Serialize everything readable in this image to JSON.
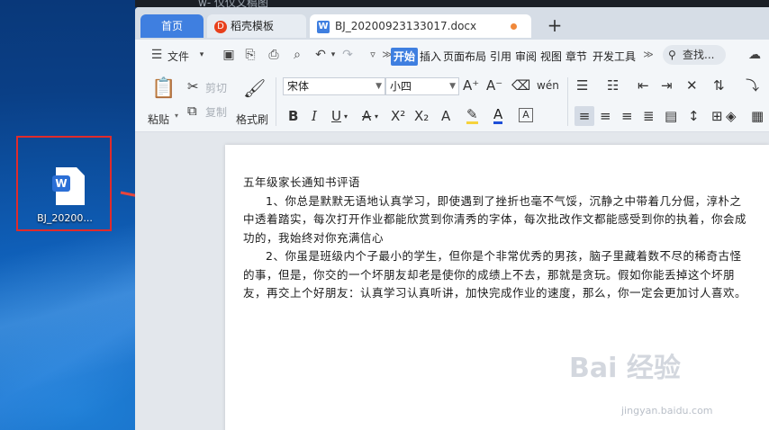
{
  "window": {
    "title_fragment": "w- 仪仪文稿图"
  },
  "desktop": {
    "icon_label": "BJ_20200...",
    "icon_badge": "W"
  },
  "tabs": {
    "home": "首页",
    "template": "稻壳模板",
    "template_icon": "D",
    "doc": "BJ_20200923133017.docx",
    "doc_icon": "W",
    "add": "+"
  },
  "menubar": {
    "file": "文件",
    "tabs": [
      "开始",
      "插入",
      "页面布局",
      "引用",
      "审阅",
      "视图",
      "章节",
      "开发工具"
    ],
    "search": "查找..."
  },
  "ribbon": {
    "paste": "粘贴",
    "cut": "剪切",
    "copy": "复制",
    "format_painter": "格式刷",
    "font_name": "宋体",
    "font_size": "小四"
  },
  "document": {
    "title": "五年级家长通知书评语",
    "paragraph1": "1、你总是默默无语地认真学习，即使遇到了挫折也毫不气馁，沉静之中带着几分倔，淳朴之中透着踏实，每次打开作业都能欣赏到你清秀的字体，每次批改作文都能感受到你的执着，你会成功的，我始终对你充满信心",
    "paragraph2": "2、你虽是班级内个子最小的学生，但你是个非常优秀的男孩，脑子里藏着数不尽的稀奇古怪的事，但是，你交的一个坏朋友却老是使你的成绩上不去，那就是贪玩。假如你能丢掉这个坏朋友，再交上个好朋友：认真学习认真听讲，加快完成作业的速度，那么，你一定会更加讨人喜欢。"
  },
  "watermark": {
    "main": "Bai 经验",
    "sub": "jingyan.baidu.com"
  },
  "colors": {
    "accent": "#3f7fe0",
    "highlight_frame": "#e02b2b"
  }
}
